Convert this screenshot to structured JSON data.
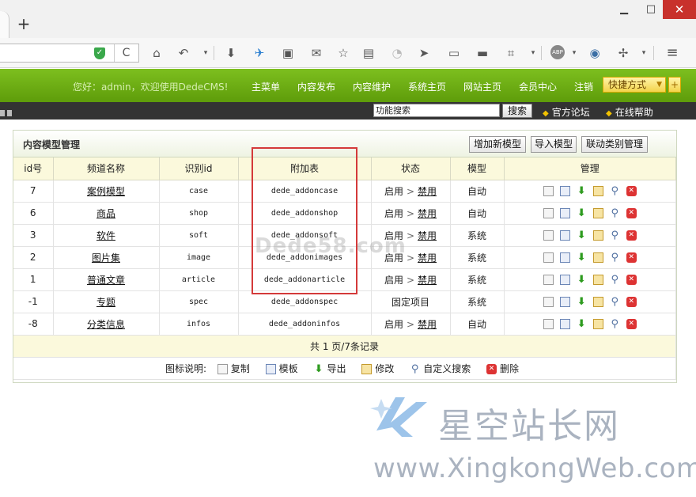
{
  "browser": {
    "newtab_label": "+",
    "window": {
      "min": "▁",
      "max": "□",
      "close": "✕"
    },
    "shield_label": "✓",
    "reload_label": "C",
    "toolbar_icons": [
      "home-icon",
      "undo-icon",
      "dropdown-icon",
      "download-icon",
      "bird-icon",
      "screenshot-icon",
      "mail-icon",
      "bookmark-star-icon",
      "reader-icon",
      "rss-icon",
      "send-icon",
      "window-icon",
      "folder-icon",
      "crop-icon",
      "dropdown-icon",
      "abp-icon",
      "globe-icon",
      "plane-icon",
      "dropdown-icon",
      "menu-icon"
    ]
  },
  "header": {
    "welcome": "您好：admin，欢迎使用DedeCMS!",
    "nav": [
      "主菜单",
      "内容发布",
      "内容维护",
      "系统主页",
      "网站主页",
      "会员中心",
      "注销"
    ],
    "quick": "快捷方式",
    "quick_plus": "+"
  },
  "subbar": {
    "search_value": "功能搜索",
    "search_button": "搜索",
    "links": [
      "官方论坛",
      "在线帮助"
    ]
  },
  "panel": {
    "title": "内容模型管理",
    "buttons": [
      "增加新模型",
      "导入模型",
      "联动类别管理"
    ],
    "columns": [
      "id号",
      "频道名称",
      "识别id",
      "附加表",
      "状态",
      "模型",
      "管理"
    ],
    "rows": [
      {
        "id": "7",
        "name": "案例模型",
        "nid": "case",
        "table": "dede_addoncase",
        "status_on": "启用",
        "status_action": "禁用",
        "model": "自动"
      },
      {
        "id": "6",
        "name": "商品",
        "nid": "shop",
        "table": "dede_addonshop",
        "status_on": "启用",
        "status_action": "禁用",
        "model": "自动"
      },
      {
        "id": "3",
        "name": "软件",
        "nid": "soft",
        "table": "dede_addonsoft",
        "status_on": "启用",
        "status_action": "禁用",
        "model": "系统"
      },
      {
        "id": "2",
        "name": "图片集",
        "nid": "image",
        "table": "dede_addonimages",
        "status_on": "启用",
        "status_action": "禁用",
        "model": "系统"
      },
      {
        "id": "1",
        "name": "普通文章",
        "nid": "article",
        "table": "dede_addonarticle",
        "status_on": "启用",
        "status_action": "禁用",
        "model": "系统"
      },
      {
        "id": "-1",
        "name": "专题",
        "nid": "spec",
        "table": "dede_addonspec",
        "status_fixed": "固定项目",
        "model": "系统"
      },
      {
        "id": "-8",
        "name": "分类信息",
        "nid": "infos",
        "table": "dede_addoninfos",
        "status_on": "启用",
        "status_action": "禁用",
        "model": "自动"
      }
    ],
    "pagination": "共 1 页/7条记录",
    "legend_label": "图标说明:",
    "legend": [
      "复制",
      "模板",
      "导出",
      "修改",
      "自定义搜索",
      "删除"
    ]
  },
  "watermark": {
    "site": "Dede58.com",
    "brand_cn": "星空站长网",
    "brand_url": "www.XingkongWeb.com"
  },
  "colors": {
    "accent_green": "#6aab14",
    "highlight_red": "#d43a3a",
    "header_yellow": "#fbf9dc"
  }
}
